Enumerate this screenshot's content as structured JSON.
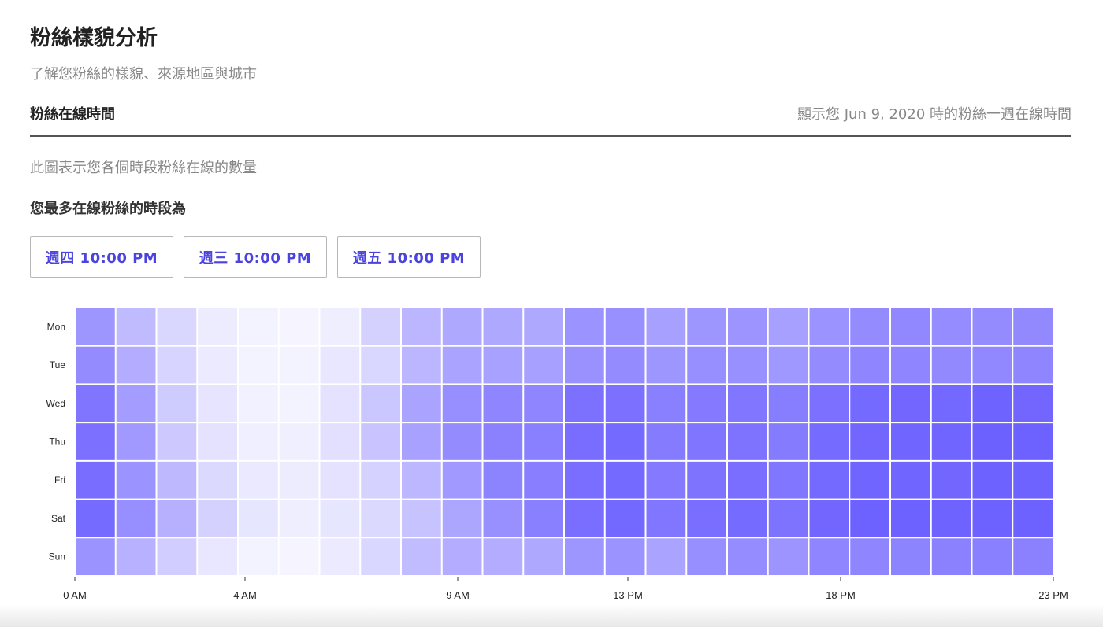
{
  "header": {
    "title": "粉絲樣貌分析",
    "subtitle": "了解您粉絲的樣貌、來源地區與城市"
  },
  "section": {
    "title": "粉絲在線時間",
    "note": "顯示您 Jun 9, 2020 時的粉絲一週在線時間",
    "description": "此圖表示您各個時段粉絲在線的數量",
    "peak_title": "您最多在線粉絲的時段為"
  },
  "peak_times": [
    {
      "label": "週四 10:00 PM"
    },
    {
      "label": "週三 10:00 PM"
    },
    {
      "label": "週五 10:00 PM"
    }
  ],
  "colors": {
    "accent": "#4b43e0",
    "cell_high": "#6c60ff",
    "cell_low": "#ffffff",
    "divider": "#555555",
    "muted_text": "#888888"
  },
  "chart_data": {
    "type": "heatmap",
    "days": [
      "Mon",
      "Tue",
      "Wed",
      "Thu",
      "Fri",
      "Sat",
      "Sun"
    ],
    "hours": [
      0,
      1,
      2,
      3,
      4,
      5,
      6,
      7,
      8,
      9,
      10,
      11,
      12,
      13,
      14,
      15,
      16,
      17,
      18,
      19,
      20,
      21,
      22,
      23
    ],
    "x_tick_labels": [
      "0 AM",
      "4 AM",
      "9 AM",
      "13 PM",
      "18 PM",
      "23 PM"
    ],
    "x_tick_hours": [
      0,
      4,
      9,
      13,
      18,
      23
    ],
    "value_scale": [
      0,
      1
    ],
    "values": [
      [
        0.66,
        0.43,
        0.25,
        0.12,
        0.08,
        0.06,
        0.11,
        0.29,
        0.46,
        0.55,
        0.55,
        0.55,
        0.68,
        0.7,
        0.6,
        0.66,
        0.67,
        0.6,
        0.68,
        0.73,
        0.75,
        0.72,
        0.73,
        0.74
      ],
      [
        0.73,
        0.52,
        0.27,
        0.13,
        0.08,
        0.08,
        0.15,
        0.26,
        0.46,
        0.58,
        0.59,
        0.6,
        0.69,
        0.73,
        0.66,
        0.71,
        0.7,
        0.65,
        0.73,
        0.76,
        0.76,
        0.74,
        0.75,
        0.77
      ],
      [
        0.87,
        0.62,
        0.33,
        0.17,
        0.09,
        0.08,
        0.18,
        0.36,
        0.58,
        0.71,
        0.76,
        0.77,
        0.89,
        0.9,
        0.8,
        0.84,
        0.86,
        0.82,
        0.9,
        0.94,
        0.96,
        0.95,
        0.98,
        0.96
      ],
      [
        0.9,
        0.64,
        0.34,
        0.18,
        0.1,
        0.1,
        0.2,
        0.37,
        0.59,
        0.73,
        0.79,
        0.8,
        0.92,
        0.94,
        0.83,
        0.87,
        0.88,
        0.83,
        0.93,
        0.96,
        0.97,
        0.97,
        1.0,
        0.99
      ],
      [
        0.92,
        0.68,
        0.44,
        0.24,
        0.14,
        0.12,
        0.18,
        0.28,
        0.45,
        0.64,
        0.78,
        0.81,
        0.91,
        0.94,
        0.84,
        0.88,
        0.91,
        0.86,
        0.94,
        0.97,
        0.97,
        0.96,
        0.99,
        0.98
      ],
      [
        0.93,
        0.71,
        0.5,
        0.29,
        0.16,
        0.11,
        0.16,
        0.24,
        0.38,
        0.56,
        0.7,
        0.8,
        0.91,
        0.95,
        0.86,
        0.91,
        0.93,
        0.88,
        0.96,
        0.99,
        0.99,
        0.98,
        0.99,
        0.99
      ],
      [
        0.68,
        0.49,
        0.31,
        0.15,
        0.08,
        0.06,
        0.13,
        0.26,
        0.42,
        0.52,
        0.52,
        0.55,
        0.66,
        0.68,
        0.58,
        0.71,
        0.72,
        0.67,
        0.76,
        0.76,
        0.78,
        0.79,
        0.8,
        0.79
      ]
    ],
    "title": "",
    "xlabel": "",
    "ylabel": "",
    "legend": "none"
  }
}
